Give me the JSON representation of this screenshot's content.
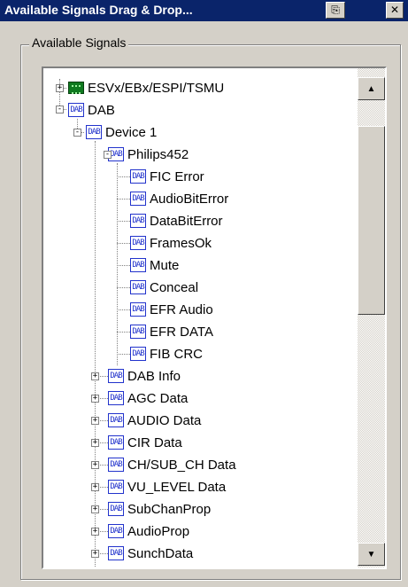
{
  "window": {
    "title": "Available Signals Drag & Drop...",
    "print_icon": "printer-icon",
    "close_icon": "close-icon"
  },
  "group": {
    "label": "Available Signals"
  },
  "tree": {
    "root_items": [
      {
        "label": "ESVx/EBx/ESPI/TSMU",
        "icon": "board-icon",
        "expander": "+"
      },
      {
        "label": "DAB",
        "icon": "dab-icon",
        "expander": "-"
      }
    ],
    "device": {
      "label": "Device 1",
      "icon": "dab-icon",
      "expander": "-"
    },
    "philips": {
      "label": "Philips452",
      "icon": "dab-icon",
      "expander": "-"
    },
    "signals": [
      "FIC Error",
      "AudioBitError",
      "DataBitError",
      "FramesOk",
      "Mute",
      "Conceal",
      "EFR Audio",
      "EFR DATA",
      "FIB CRC"
    ],
    "groups": [
      "DAB Info",
      "AGC Data",
      "AUDIO Data",
      "CIR Data",
      "CH/SUB_CH Data",
      "VU_LEVEL Data",
      "SubChanProp",
      "AudioProp",
      "SunchData"
    ],
    "dab_icon_text": "DAB"
  },
  "scrollbar": {
    "up": "▲",
    "down": "▼"
  }
}
